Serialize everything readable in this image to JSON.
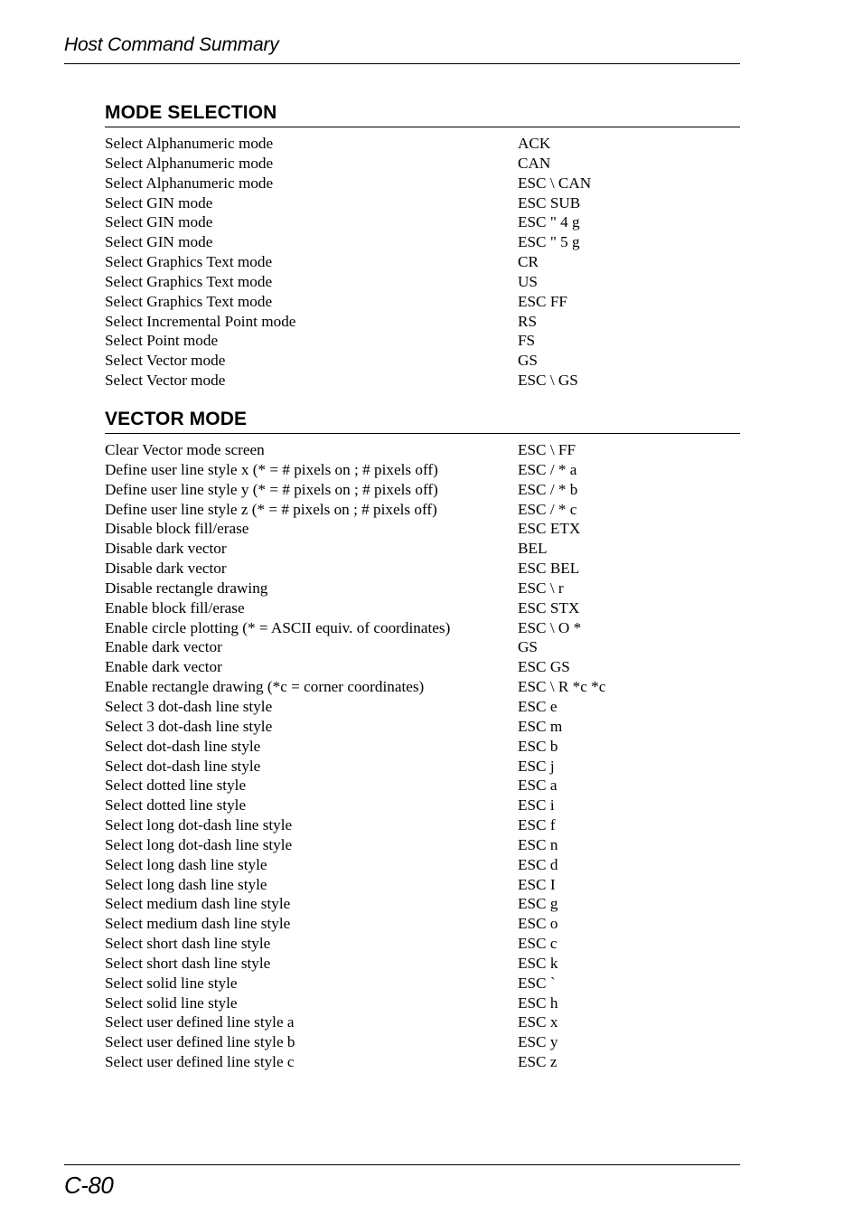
{
  "header": {
    "title": "Host Command Summary"
  },
  "sections": [
    {
      "title": "MODE SELECTION",
      "rows": [
        {
          "desc": "Select Alphanumeric mode",
          "cmd": "ACK"
        },
        {
          "desc": "Select Alphanumeric mode",
          "cmd": "CAN"
        },
        {
          "desc": "Select Alphanumeric mode",
          "cmd": "ESC \\ CAN"
        },
        {
          "desc": "Select GIN mode",
          "cmd": "ESC SUB"
        },
        {
          "desc": "Select GIN mode",
          "cmd": "ESC \" 4 g"
        },
        {
          "desc": "Select GIN mode",
          "cmd": "ESC \" 5 g"
        },
        {
          "desc": "Select Graphics Text mode",
          "cmd": "CR"
        },
        {
          "desc": "Select Graphics Text mode",
          "cmd": "US"
        },
        {
          "desc": "Select Graphics Text mode",
          "cmd": "ESC FF"
        },
        {
          "desc": "Select Incremental Point mode",
          "cmd": "RS"
        },
        {
          "desc": "Select Point mode",
          "cmd": "FS"
        },
        {
          "desc": "Select Vector mode",
          "cmd": "GS"
        },
        {
          "desc": "Select Vector mode",
          "cmd": "ESC \\ GS"
        }
      ]
    },
    {
      "title": "VECTOR MODE",
      "rows": [
        {
          "desc": "Clear Vector mode screen",
          "cmd": "ESC \\ FF"
        },
        {
          "desc": "Define user line style x (* = # pixels on ; # pixels off)",
          "cmd": "ESC / * a"
        },
        {
          "desc": "Define user line style y (* = # pixels on ; # pixels off)",
          "cmd": "ESC / * b"
        },
        {
          "desc": "Define user line style z (* = # pixels on ; # pixels off)",
          "cmd": "ESC / * c"
        },
        {
          "desc": "Disable block fill/erase",
          "cmd": "ESC ETX"
        },
        {
          "desc": "Disable dark vector",
          "cmd": "BEL"
        },
        {
          "desc": "Disable dark vector",
          "cmd": "ESC BEL"
        },
        {
          "desc": "Disable rectangle drawing",
          "cmd": "ESC \\ r"
        },
        {
          "desc": "Enable block fill/erase",
          "cmd": "ESC STX"
        },
        {
          "desc": "Enable circle plotting (* = ASCII equiv. of coordinates)",
          "cmd": "ESC \\ O *"
        },
        {
          "desc": "Enable dark vector",
          "cmd": "GS"
        },
        {
          "desc": "Enable dark vector",
          "cmd": "ESC GS"
        },
        {
          "desc": "Enable rectangle drawing (*c = corner coordinates)",
          "cmd": "ESC \\ R *c *c"
        },
        {
          "desc": "Select 3 dot-dash line style",
          "cmd": "ESC e"
        },
        {
          "desc": "Select 3 dot-dash line style",
          "cmd": "ESC m"
        },
        {
          "desc": "Select dot-dash line style",
          "cmd": "ESC b"
        },
        {
          "desc": "Select dot-dash line style",
          "cmd": "ESC j"
        },
        {
          "desc": "Select dotted line style",
          "cmd": "ESC a"
        },
        {
          "desc": "Select dotted line style",
          "cmd": "ESC i"
        },
        {
          "desc": "Select long dot-dash line style",
          "cmd": "ESC f"
        },
        {
          "desc": "Select long dot-dash line style",
          "cmd": "ESC n"
        },
        {
          "desc": "Select long dash line style",
          "cmd": "ESC d"
        },
        {
          "desc": "Select long dash line style",
          "cmd": "ESC I"
        },
        {
          "desc": "Select medium dash line style",
          "cmd": "ESC g"
        },
        {
          "desc": "Select medium dash line style",
          "cmd": "ESC o"
        },
        {
          "desc": "Select short dash line style",
          "cmd": "ESC c"
        },
        {
          "desc": "Select short dash line style",
          "cmd": "ESC k"
        },
        {
          "desc": "Select solid line style",
          "cmd": "ESC `"
        },
        {
          "desc": "Select solid line style",
          "cmd": "ESC h"
        },
        {
          "desc": "Select user defined line style a",
          "cmd": "ESC x"
        },
        {
          "desc": "Select user defined line style b",
          "cmd": "ESC y"
        },
        {
          "desc": "Select user defined line style c",
          "cmd": "ESC z"
        }
      ]
    }
  ],
  "footer": {
    "page_number": "C-80"
  }
}
